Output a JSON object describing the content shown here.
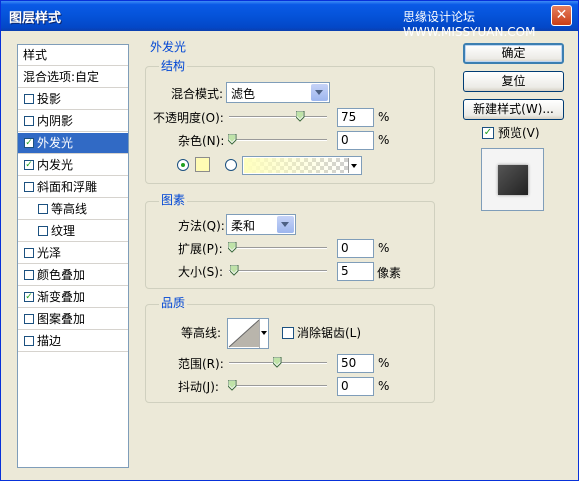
{
  "window": {
    "title": "图层样式",
    "watermark": "思缘设计论坛 WWW.MISSYUAN.COM",
    "close_glyph": "✕"
  },
  "style_list": {
    "header": "样式",
    "blend": "混合选项:自定",
    "items": [
      {
        "label": "投影",
        "checked": false
      },
      {
        "label": "内阴影",
        "checked": false
      },
      {
        "label": "外发光",
        "checked": true,
        "selected": true
      },
      {
        "label": "内发光",
        "checked": true
      },
      {
        "label": "斜面和浮雕",
        "checked": false
      },
      {
        "label": "等高线",
        "checked": false,
        "indent": true
      },
      {
        "label": "纹理",
        "checked": false,
        "indent": true
      },
      {
        "label": "光泽",
        "checked": false
      },
      {
        "label": "颜色叠加",
        "checked": false
      },
      {
        "label": "渐变叠加",
        "checked": true
      },
      {
        "label": "图案叠加",
        "checked": false
      },
      {
        "label": "描边",
        "checked": false
      }
    ]
  },
  "outer_glow": {
    "section_title": "外发光",
    "structure": {
      "title": "结构",
      "blend_mode_label": "混合模式:",
      "blend_mode_value": "滤色",
      "opacity_label": "不透明度(O):",
      "opacity_value": "75",
      "opacity_fraction": 0.75,
      "noise_label": "杂色(N):",
      "noise_value": "0",
      "noise_fraction": 0.0,
      "glow_color": "#fffbb4",
      "percent": "%"
    },
    "elements": {
      "title": "图素",
      "technique_label": "方法(Q):",
      "technique_value": "柔和",
      "spread_label": "扩展(P):",
      "spread_value": "0",
      "spread_fraction": 0.0,
      "size_label": "大小(S):",
      "size_value": "5",
      "size_fraction": 0.02,
      "size_unit": "像素",
      "percent": "%"
    },
    "quality": {
      "title": "品质",
      "contour_label": "等高线:",
      "antialias_label": "消除锯齿(L)",
      "antialias_checked": false,
      "range_label": "范围(R):",
      "range_value": "50",
      "range_fraction": 0.5,
      "jitter_label": "抖动(J):",
      "jitter_value": "0",
      "jitter_fraction": 0.0,
      "percent": "%"
    }
  },
  "buttons": {
    "ok": "确定",
    "reset": "复位",
    "new_style": "新建样式(W)...",
    "preview_label": "预览(V)",
    "preview_checked": true
  },
  "colors": {
    "accent": "#316ac5",
    "group_title": "#0046d5",
    "check": "#21a121"
  }
}
